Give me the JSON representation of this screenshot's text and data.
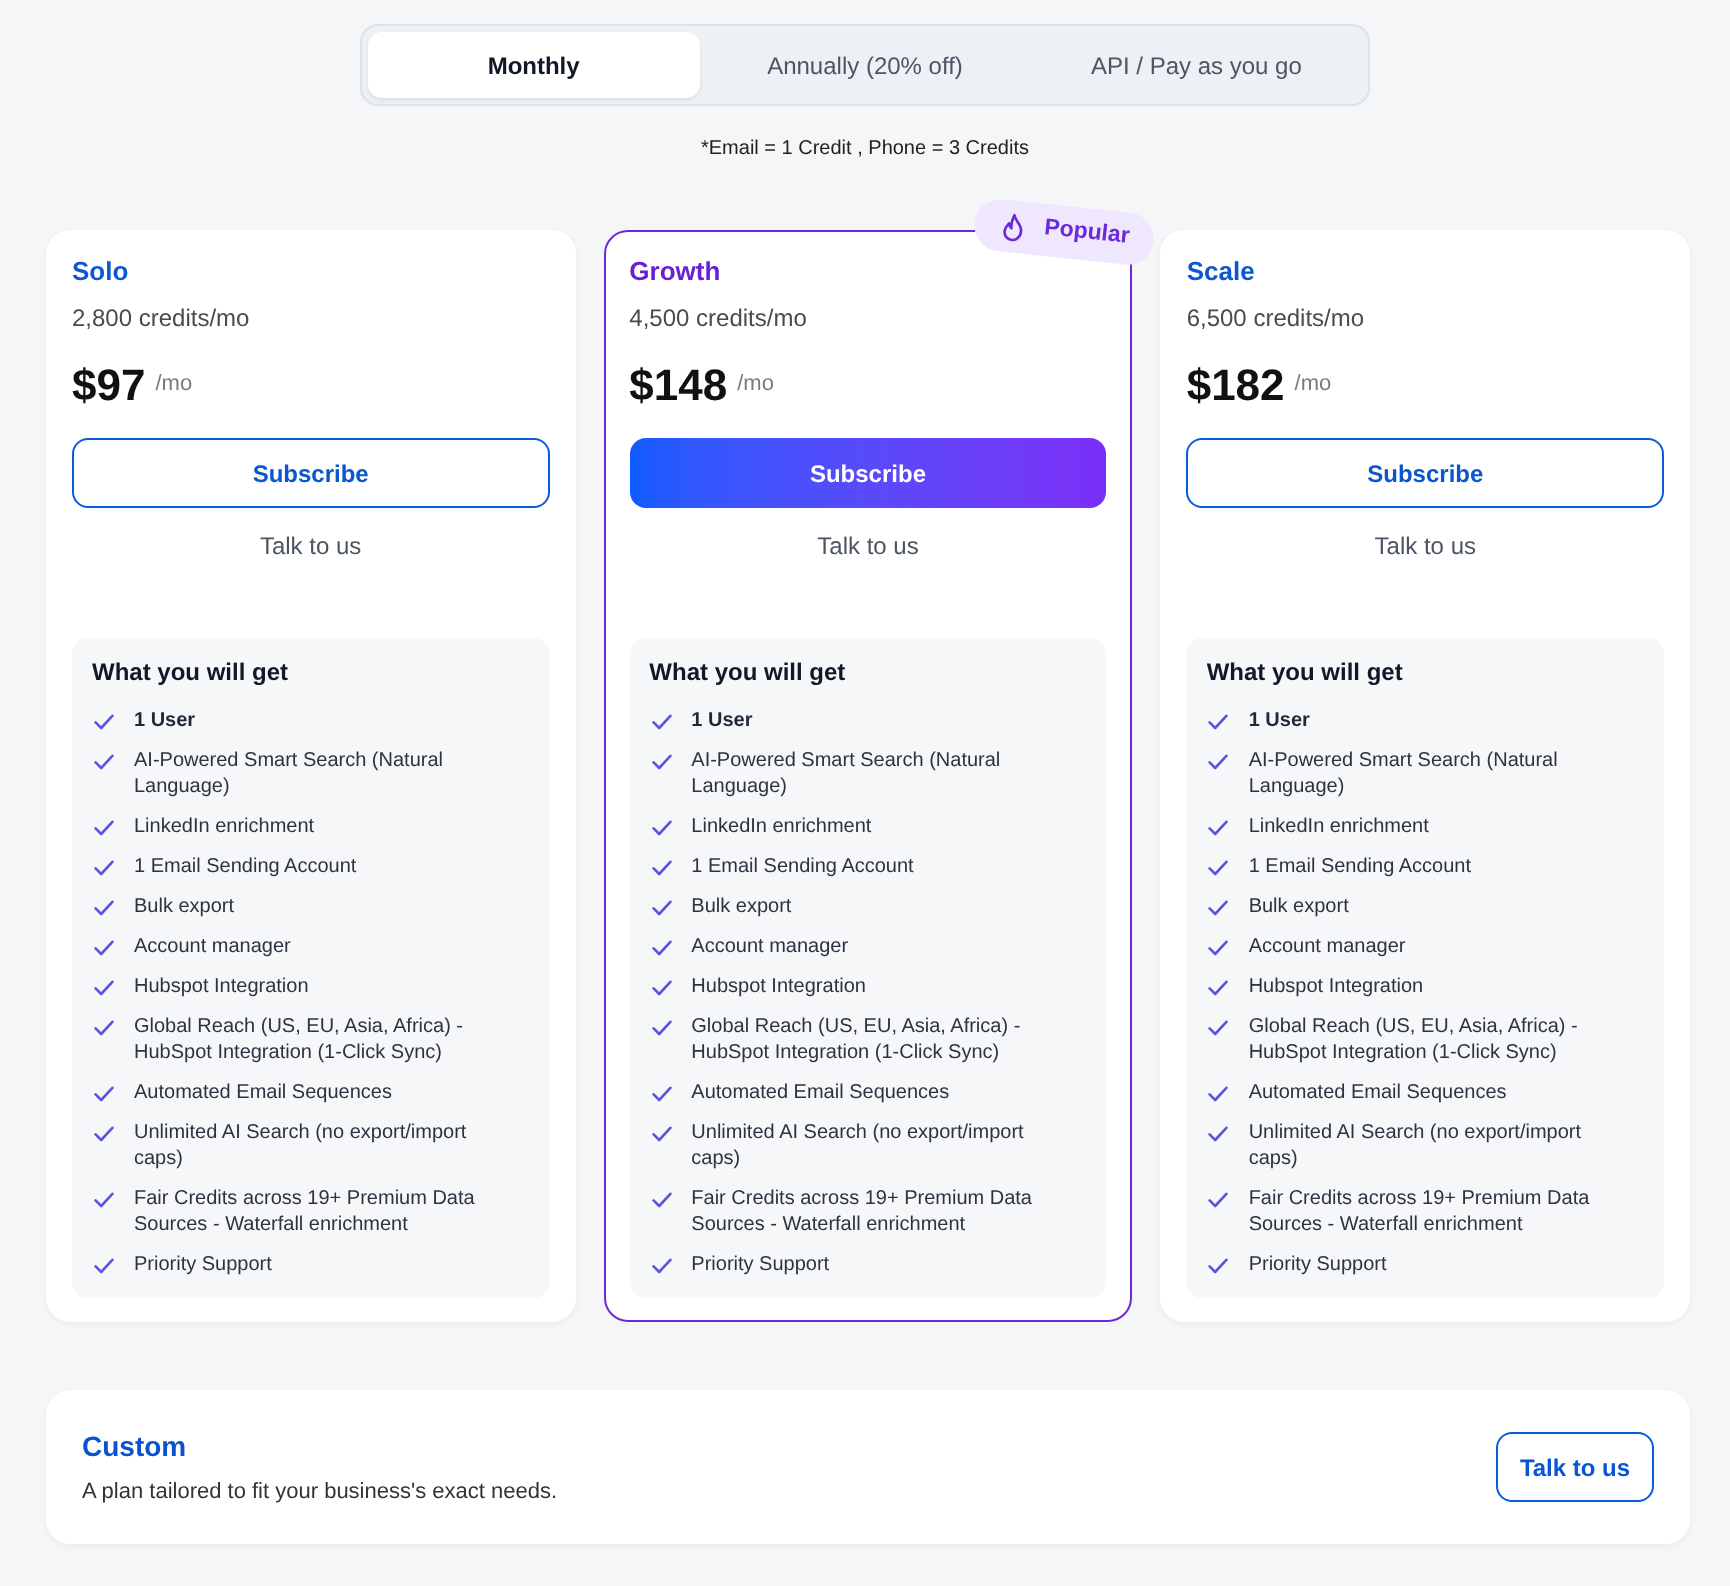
{
  "billing_tabs": [
    {
      "label": "Monthly",
      "selected": true
    },
    {
      "label": "Annually (20% off)",
      "selected": false
    },
    {
      "label": "API / Pay as you go",
      "selected": false
    }
  ],
  "credits_note": "*Email = 1 Credit , Phone = 3 Credits",
  "plans": [
    {
      "name": "Solo",
      "highlighted": false,
      "credits": "2,800 credits/mo",
      "price": "$97",
      "period": "/mo",
      "subscribe_button": "Subscribe",
      "contact_link": "Talk to us",
      "features_title": "What you will get",
      "features": [
        {
          "text": "1 User",
          "bold": true
        },
        {
          "text": "AI-Powered Smart Search (Natural Language)",
          "bold": false
        },
        {
          "text": "LinkedIn enrichment",
          "bold": false
        },
        {
          "text": "1 Email Sending Account",
          "bold": false
        },
        {
          "text": "Bulk export",
          "bold": false
        },
        {
          "text": "Account manager",
          "bold": false
        },
        {
          "text": "Hubspot Integration",
          "bold": false
        },
        {
          "text": "Global Reach (US, EU, Asia, Africa) - HubSpot Integration (1-Click Sync)",
          "bold": false
        },
        {
          "text": "Automated Email Sequences",
          "bold": false
        },
        {
          "text": "Unlimited AI Search (no export/import caps)",
          "bold": false
        },
        {
          "text": "Fair Credits across 19+ Premium Data Sources - Waterfall enrichment",
          "bold": false
        },
        {
          "text": "Priority Support",
          "bold": false
        }
      ]
    },
    {
      "name": "Growth",
      "highlighted": true,
      "badge": "Popular",
      "credits": "4,500 credits/mo",
      "price": "$148",
      "period": "/mo",
      "subscribe_button": "Subscribe",
      "contact_link": "Talk to us",
      "features_title": "What you will get",
      "features": [
        {
          "text": "1 User",
          "bold": true
        },
        {
          "text": "AI-Powered Smart Search (Natural Language)",
          "bold": false
        },
        {
          "text": "LinkedIn enrichment",
          "bold": false
        },
        {
          "text": "1 Email Sending Account",
          "bold": false
        },
        {
          "text": "Bulk export",
          "bold": false
        },
        {
          "text": "Account manager",
          "bold": false
        },
        {
          "text": "Hubspot Integration",
          "bold": false
        },
        {
          "text": "Global Reach (US, EU, Asia, Africa) - HubSpot Integration (1-Click Sync)",
          "bold": false
        },
        {
          "text": "Automated Email Sequences",
          "bold": false
        },
        {
          "text": "Unlimited AI Search (no export/import caps)",
          "bold": false
        },
        {
          "text": "Fair Credits across 19+ Premium Data Sources - Waterfall enrichment",
          "bold": false
        },
        {
          "text": "Priority Support",
          "bold": false
        }
      ]
    },
    {
      "name": "Scale",
      "highlighted": false,
      "credits": "6,500 credits/mo",
      "price": "$182",
      "period": "/mo",
      "subscribe_button": "Subscribe",
      "contact_link": "Talk to us",
      "features_title": "What you will get",
      "features": [
        {
          "text": "1 User",
          "bold": true
        },
        {
          "text": "AI-Powered Smart Search (Natural Language)",
          "bold": false
        },
        {
          "text": "LinkedIn enrichment",
          "bold": false
        },
        {
          "text": "1 Email Sending Account",
          "bold": false
        },
        {
          "text": "Bulk export",
          "bold": false
        },
        {
          "text": "Account manager",
          "bold": false
        },
        {
          "text": "Hubspot Integration",
          "bold": false
        },
        {
          "text": "Global Reach (US, EU, Asia, Africa) - HubSpot Integration (1-Click Sync)",
          "bold": false
        },
        {
          "text": "Automated Email Sequences",
          "bold": false
        },
        {
          "text": "Unlimited AI Search (no export/import caps)",
          "bold": false
        },
        {
          "text": "Fair Credits across 19+ Premium Data Sources - Waterfall enrichment",
          "bold": false
        },
        {
          "text": "Priority Support",
          "bold": false
        }
      ]
    }
  ],
  "custom_plan": {
    "name": "Custom",
    "description": "A plan tailored to fit your business's exact needs.",
    "button": "Talk to us"
  }
}
